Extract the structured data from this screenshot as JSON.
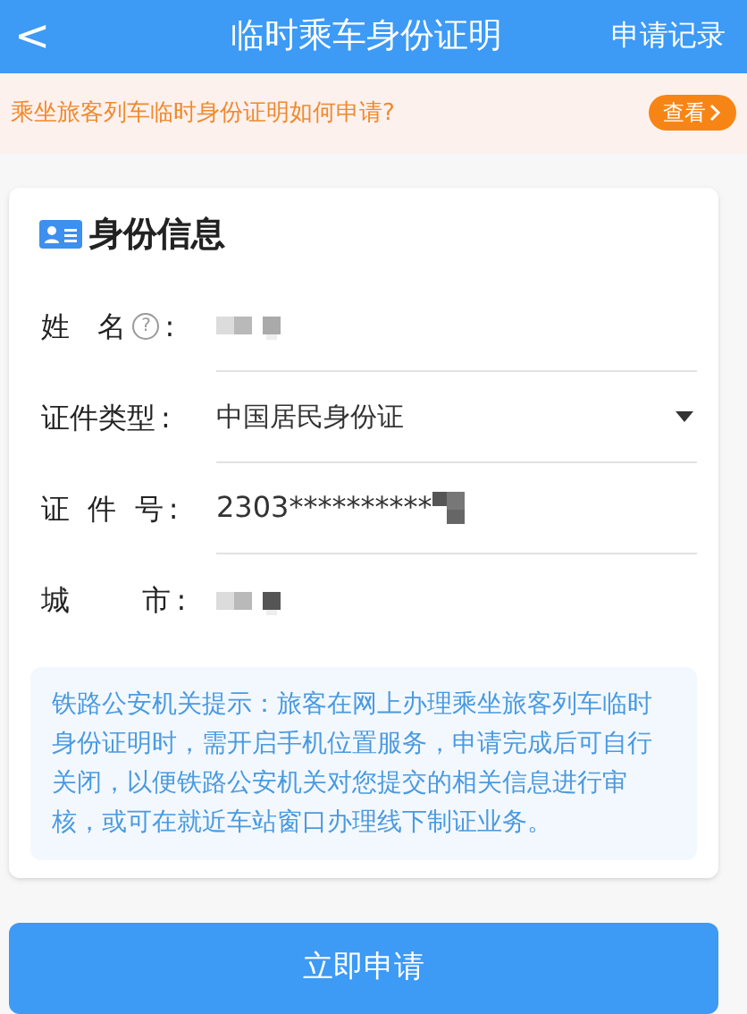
{
  "header": {
    "back": "<",
    "title": "临时乘车身份证明",
    "action": "申请记录"
  },
  "banner": {
    "text": "乘坐旅客列车临时身份证明如何申请?",
    "button": "查看"
  },
  "section": {
    "title": "身份信息"
  },
  "fields": [
    {
      "kind": "redacted",
      "label": "姓   名",
      "help": "?",
      "colon": ":"
    },
    {
      "kind": "select",
      "label": "证件类型",
      "colon": ":",
      "value": "中国居民身份证"
    },
    {
      "kind": "partial",
      "label": "证  件  号",
      "colon": ":",
      "value": "2303**********"
    },
    {
      "kind": "redacted",
      "label": "城        市",
      "colon": ":"
    }
  ],
  "notice": "铁路公安机关提示：旅客在网上办理乘坐旅客列车临时身份证明时，需开启手机位置服务，申请完成后可自行关闭，以便铁路公安机关对您提交的相关信息进行审核，或可在就近车站窗口办理线下制证业务。",
  "submit": "立即申请"
}
